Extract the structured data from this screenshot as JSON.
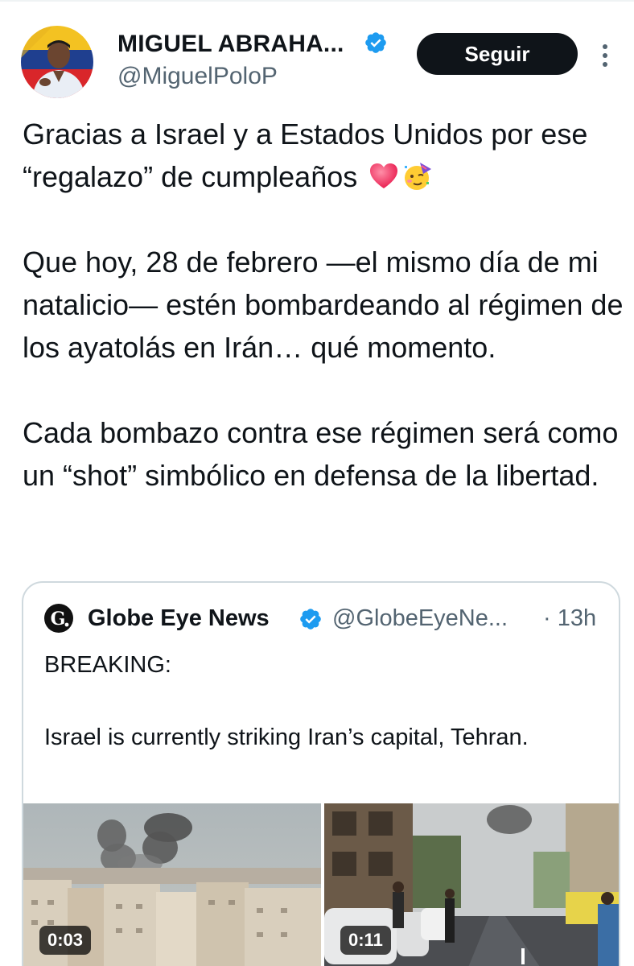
{
  "author": {
    "display_name": "MIGUEL ABRAHA...",
    "handle": "@MiguelPoloP",
    "follow_label": "Seguir"
  },
  "tweet": {
    "paragraph_1": "Gracias a Israel y a Estados Unidos por ese “regalazo” de cumpleaños",
    "paragraph_1_emojis": [
      "heart",
      "partying-face"
    ],
    "paragraph_2": "Que hoy, 28 de febrero —el mismo día de mi natalicio— estén bombardeando al régimen de los ayatolás en Irán… qué momento.",
    "paragraph_3": "Cada bombazo contra ese régimen será como un “shot” simbólico en defensa de la libertad."
  },
  "quoted": {
    "logo_letter": "G.",
    "name": "Globe Eye News",
    "handle": "@GlobeEyeNe...",
    "time": "· 13h",
    "line_1": "BREAKING:",
    "line_2": "Israel is currently striking Iran’s capital, Tehran.",
    "videos": [
      {
        "duration": "0:03"
      },
      {
        "duration": "0:11"
      }
    ]
  },
  "colors": {
    "text": "#0f1419",
    "secondary": "#536471",
    "verified": "#1d9bf0",
    "border": "#cfd9de",
    "button": "#0f1419"
  }
}
